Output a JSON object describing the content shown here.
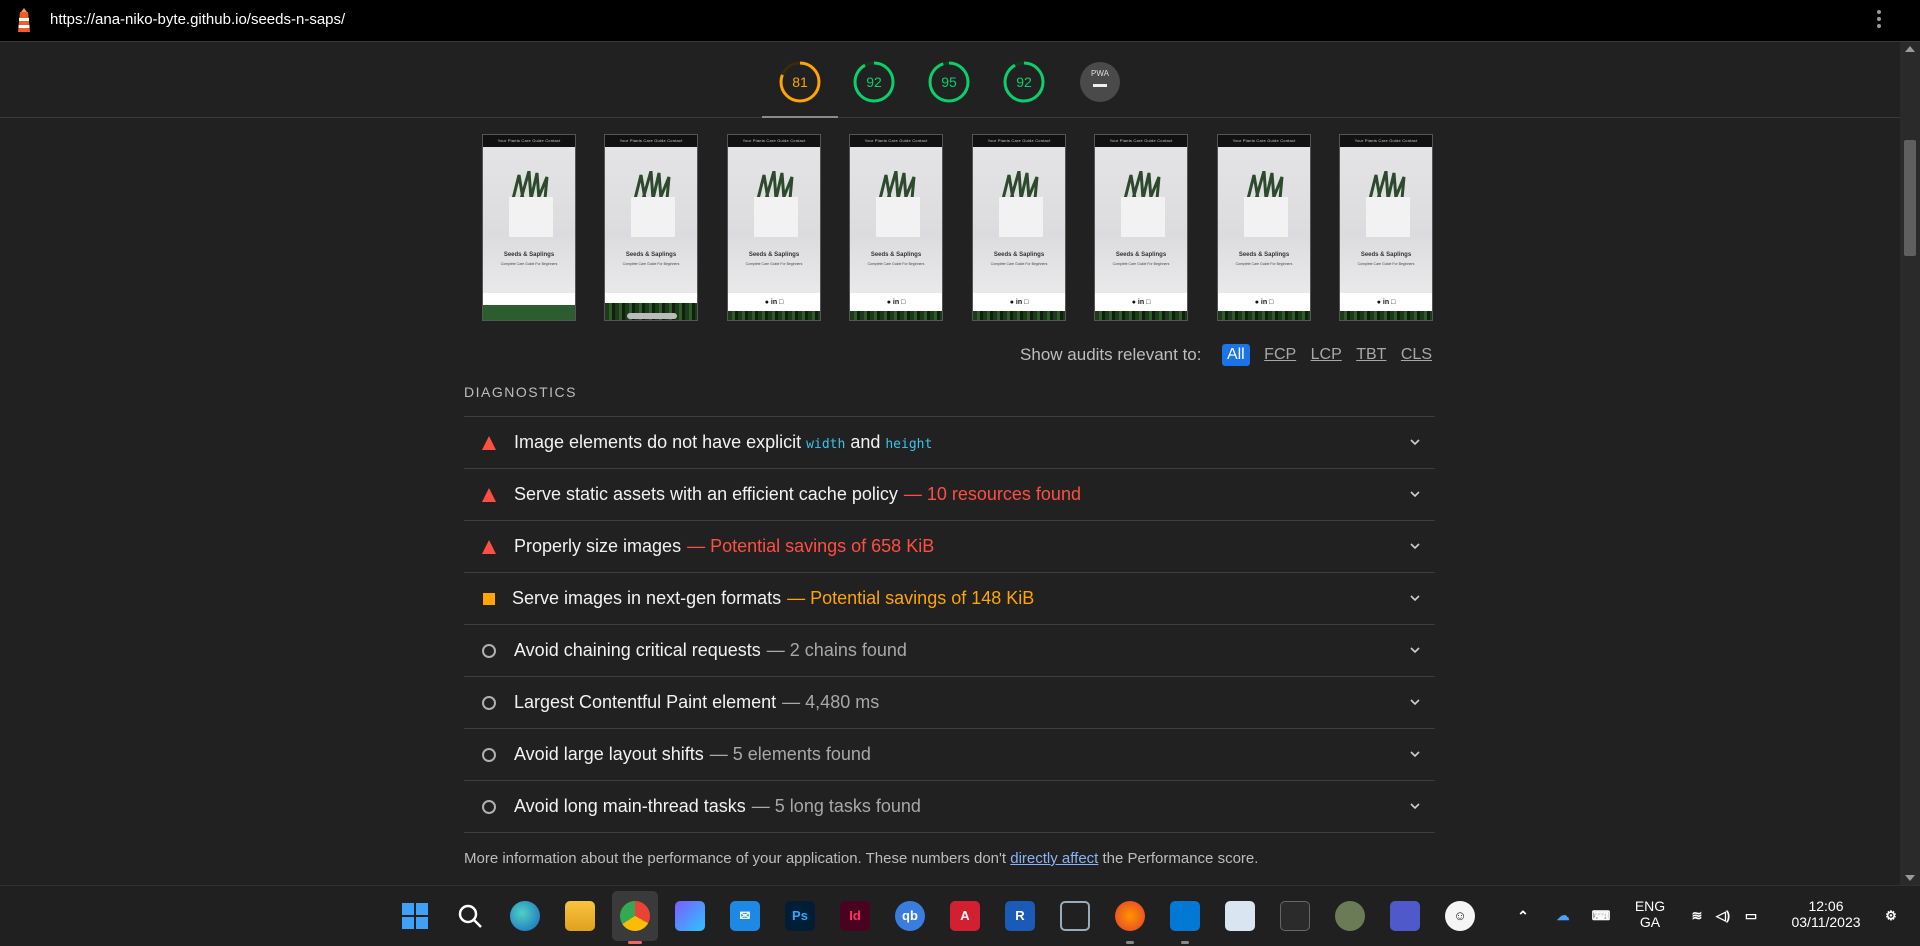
{
  "browser": {
    "url": "https://ana-niko-byte.github.io/seeds-n-saps/"
  },
  "scores": [
    {
      "value": "81",
      "color": "#ffa400",
      "fraction": 0.81
    },
    {
      "value": "92",
      "color": "#0cce6b",
      "fraction": 0.92
    },
    {
      "value": "95",
      "color": "#0cce6b",
      "fraction": 0.95
    },
    {
      "value": "92",
      "color": "#0cce6b",
      "fraction": 0.92
    }
  ],
  "pwa_label": "PWA",
  "filmstrip": {
    "nav_text": "Your Plants   Care Guide   Contact",
    "title": "Seeds & Saplings",
    "subtitle": "Complete Care Guide For Beginners",
    "social_icons": "● in □"
  },
  "filter": {
    "label": "Show audits relevant to:",
    "chips": [
      "All",
      "FCP",
      "LCP",
      "TBT",
      "CLS"
    ]
  },
  "diagnostics": {
    "title": "DIAGNOSTICS",
    "audits": [
      {
        "status": "fail",
        "title_pre": "Image elements do not have explicit ",
        "code1": "width",
        "mid": " and ",
        "code2": "height",
        "display": ""
      },
      {
        "status": "fail",
        "title": "Serve static assets with an efficient cache policy",
        "display": "— 10 resources found"
      },
      {
        "status": "fail",
        "title": "Properly size images",
        "display": "— Potential savings of 658 KiB"
      },
      {
        "status": "average",
        "title": "Serve images in next-gen formats",
        "display": "— Potential savings of 148 KiB"
      },
      {
        "status": "info",
        "title": "Avoid chaining critical requests",
        "display": "— 2 chains found"
      },
      {
        "status": "info",
        "title": "Largest Contentful Paint element",
        "display": "— 4,480 ms"
      },
      {
        "status": "info",
        "title": "Avoid large layout shifts",
        "display": "— 5 elements found"
      },
      {
        "status": "info",
        "title": "Avoid long main-thread tasks",
        "display": "— 5 long tasks found"
      }
    ],
    "footnote_pre": "More information about the performance of your application. These numbers don't ",
    "footnote_link": "directly affect",
    "footnote_post": " the Performance score."
  },
  "taskbar": {
    "apps": [
      "start",
      "search",
      "edge",
      "file-explorer",
      "chrome",
      "copilot",
      "mail",
      "photoshop",
      "indesign",
      "qbittorrent",
      "autocad",
      "revit",
      "3d-viewer",
      "firefox",
      "vscode",
      "notepad",
      "terminal",
      "evernote",
      "teams",
      "emoji"
    ],
    "labels": {
      "photoshop": "Ps",
      "indesign": "Id",
      "qbittorrent": "qb",
      "autocad": "A",
      "revit": "R"
    },
    "lang_1": "ENG",
    "lang_2": "GA",
    "time": "12:06",
    "date": "03/11/2023"
  }
}
